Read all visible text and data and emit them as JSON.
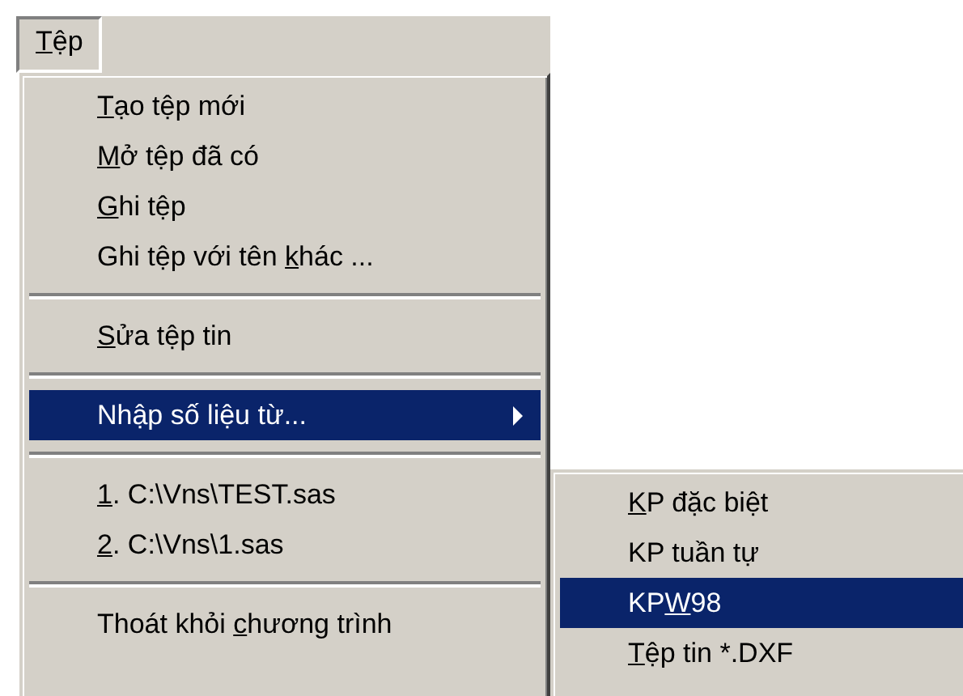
{
  "menu_bar": [
    {
      "label": {
        "access_key": "T",
        "after": "ệp"
      },
      "selected": true
    }
  ],
  "file_menu": {
    "items": [
      {
        "kind": "item",
        "label": {
          "access_key": "T",
          "after": "ạo tệp mới"
        },
        "selected": false
      },
      {
        "kind": "item",
        "label": {
          "access_key": "M",
          "after": "ở tệp đã có"
        },
        "selected": false
      },
      {
        "kind": "item",
        "label": {
          "access_key": "G",
          "after": "hi tệp"
        },
        "selected": false
      },
      {
        "kind": "item",
        "label": {
          "before": "Ghi tệp với tên ",
          "access_key": "k",
          "after": "hác ..."
        },
        "selected": false
      },
      {
        "kind": "separator"
      },
      {
        "kind": "item",
        "label": {
          "access_key": "S",
          "after": "ửa tệp tin"
        },
        "selected": false
      },
      {
        "kind": "separator"
      },
      {
        "kind": "submenu",
        "label": {
          "before": "Nhập số liệu từ..."
        },
        "selected": true
      },
      {
        "kind": "separator"
      },
      {
        "kind": "item",
        "label": {
          "access_key": "1",
          "after": ". C:\\Vns\\TEST.sas"
        },
        "selected": false
      },
      {
        "kind": "item",
        "label": {
          "access_key": "2",
          "after": ". C:\\Vns\\1.sas"
        },
        "selected": false
      },
      {
        "kind": "separator"
      },
      {
        "kind": "item",
        "label": {
          "before": "Thoát khỏi ",
          "access_key": "c",
          "after": "hương trình"
        },
        "selected": false
      }
    ]
  },
  "submenu": {
    "items": [
      {
        "kind": "item",
        "label": {
          "access_key": "K",
          "after": "P đặc biệt"
        },
        "selected": false
      },
      {
        "kind": "item",
        "label": {
          "before": "KP tuần tự"
        },
        "selected": false
      },
      {
        "kind": "item",
        "label": {
          "before": "KP",
          "access_key": "W",
          "after": "98"
        },
        "selected": true
      },
      {
        "kind": "item",
        "label": {
          "access_key": "T",
          "after": "ệp tin *.DXF"
        },
        "selected": false
      }
    ]
  }
}
